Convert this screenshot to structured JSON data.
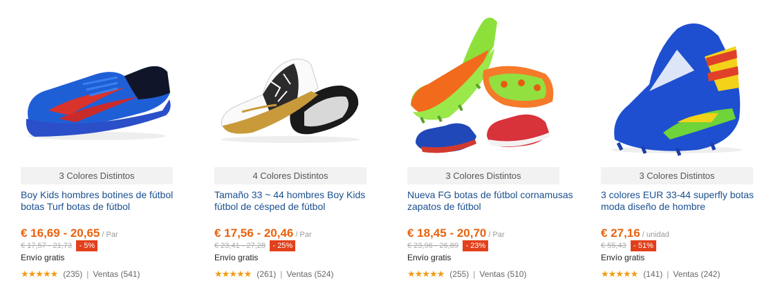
{
  "products": [
    {
      "colors_label": "3 Colores Distintos",
      "title": "Boy Kids hombres botines de fútbol botas Turf botas de fútbol",
      "price": "€ 16,69 - 20,65",
      "unit": "/ Par",
      "old_price": "€ 17,57 - 21,73",
      "discount": "- 5%",
      "shipping": "Envío gratis",
      "stars_icon": "★★★★★",
      "reviews": "(235)",
      "sales_sep": "|",
      "sales": "Ventas (541)",
      "image_icon": "turf-shoe-blue-icon"
    },
    {
      "colors_label": "4 Colores Distintos",
      "title": "Tamaño 33 ~ 44 hombres Boy Kids fútbol de césped de fútbol",
      "price": "€ 17,56 - 20,46",
      "unit": "/ Par",
      "old_price": "€ 23,41 - 27,28",
      "discount": "- 25%",
      "shipping": "Envío gratis",
      "stars_icon": "★★★★★",
      "reviews": "(261)",
      "sales_sep": "|",
      "sales": "Ventas (524)",
      "image_icon": "turf-shoe-white-gold-icon"
    },
    {
      "colors_label": "3 Colores Distintos",
      "title": "Nueva FG botas de fútbol cornamusas zapatos de fútbol",
      "price": "€ 18,45 - 20,70",
      "unit": "/ Par",
      "old_price": "€ 23,96 - 26,89",
      "discount": "- 23%",
      "shipping": "Envío gratis",
      "stars_icon": "★★★★★",
      "reviews": "(255)",
      "sales_sep": "|",
      "sales": "Ventas (510)",
      "image_icon": "cleats-orange-green-icon"
    },
    {
      "colors_label": "3 Colores Distintos",
      "title": "3 colores EUR 33-44 superfly botas moda diseño de hombre",
      "price": "€ 27,16",
      "unit": "/ unidad",
      "old_price": "€ 55,43",
      "discount": "- 51%",
      "shipping": "Envío gratis",
      "stars_icon": "★★★★★",
      "reviews": "(141)",
      "sales_sep": "|",
      "sales": "Ventas (242)",
      "image_icon": "high-top-cleat-blue-icon"
    }
  ],
  "colors": {
    "price": "#e9620c",
    "discount_bg": "#e2401c",
    "title_link": "#1a4f8f",
    "star": "#f39b12"
  }
}
